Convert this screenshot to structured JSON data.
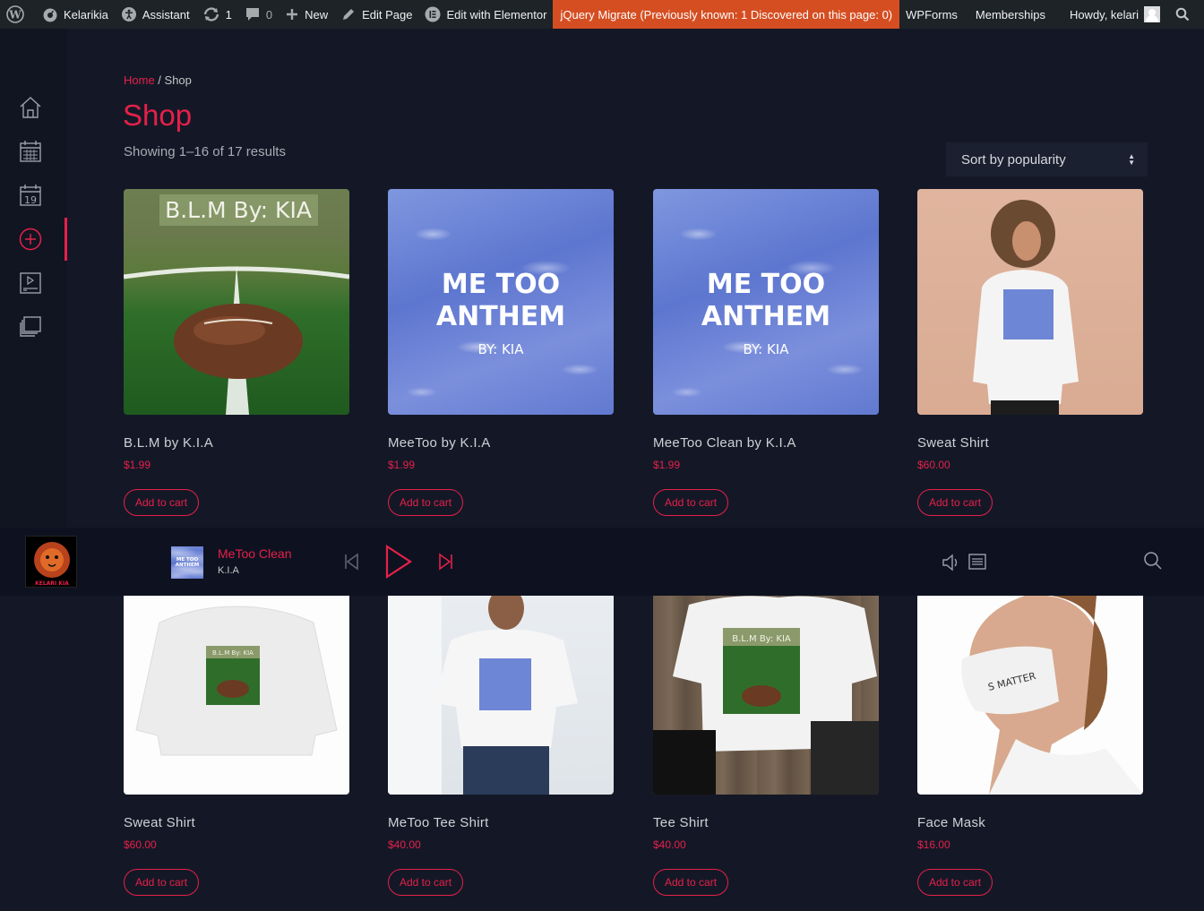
{
  "adminbar": {
    "site_name": "Kelarikia",
    "assistant": "Assistant",
    "updates_count": "1",
    "comments_count": "0",
    "new_label": "New",
    "edit_page": "Edit Page",
    "edit_elementor": "Edit with Elementor",
    "jquery_notice": "jQuery Migrate (Previously known: 1 Discovered on this page: 0)",
    "wpforms": "WPForms",
    "memberships": "Memberships",
    "howdy": "Howdy, kelari"
  },
  "sidebar": {
    "items": [
      {
        "icon": "home-icon"
      },
      {
        "icon": "calendar-icon"
      },
      {
        "icon": "calendar-day-icon"
      },
      {
        "icon": "add-circle-icon",
        "active": true
      },
      {
        "icon": "video-playlist-icon"
      },
      {
        "icon": "albums-icon"
      }
    ]
  },
  "breadcrumb": {
    "home": "Home",
    "separator": " / ",
    "current": "Shop"
  },
  "page_title": "Shop",
  "result_count": "Showing 1–16 of 17 results",
  "sort": {
    "selected": "Sort by popularity"
  },
  "add_to_cart_label": "Add to cart",
  "products": [
    {
      "name": "B.L.M by K.I.A",
      "price": "$1.99",
      "art_text": "B.L.M By: KIA"
    },
    {
      "name": "MeeToo by K.I.A",
      "price": "$1.99",
      "art_line1": "ME TOO",
      "art_line2": "ANTHEM",
      "art_by": "BY: KIA"
    },
    {
      "name": "MeeToo Clean by K.I.A",
      "price": "$1.99",
      "art_line1": "ME TOO",
      "art_line2": "ANTHEM",
      "art_by": "BY: KIA"
    },
    {
      "name": "Sweat Shirt",
      "price": "$60.00"
    },
    {
      "name": "Sweat Shirt",
      "price": "$60.00",
      "art_text": "B.L.M By: KIA"
    },
    {
      "name": "MeToo Tee Shirt",
      "price": "$40.00"
    },
    {
      "name": "Tee Shirt",
      "price": "$40.00",
      "art_text": "B.L.M By: KIA"
    },
    {
      "name": "Face Mask",
      "price": "$16.00",
      "art_text": "S MATTER"
    }
  ],
  "player": {
    "logo_text": "KELARI KIA",
    "track_title": "MeToo Clean",
    "track_artist": "K.I.A",
    "thumb_line1": "ME TOO",
    "thumb_line2": "ANTHEM"
  },
  "colors": {
    "accent": "#e5204a",
    "background": "#141826",
    "adminbar": "#1d2327",
    "jquery_badge": "#d54e21"
  }
}
